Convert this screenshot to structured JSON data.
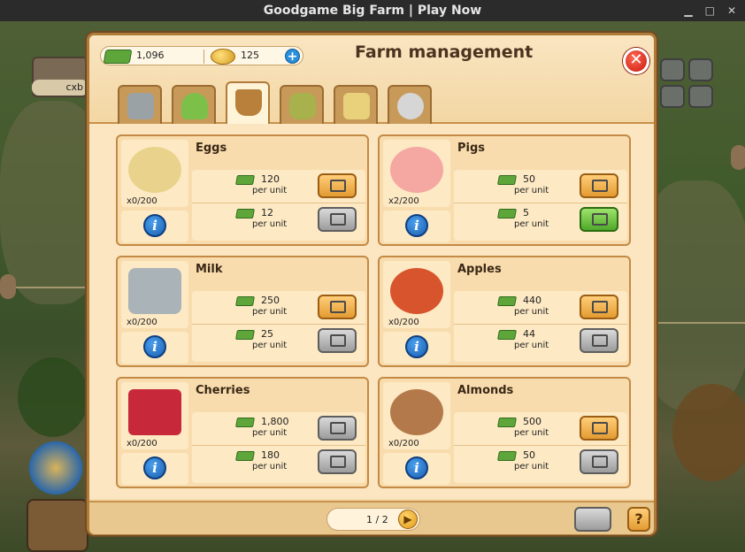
{
  "window": {
    "title": "Goodgame Big Farm | Play Now"
  },
  "hud": {
    "player_label": "cxb"
  },
  "dialog": {
    "title": "Farm management",
    "money": {
      "cash": "1,096",
      "coins": "125"
    },
    "tabs": [
      {
        "icon": "locked-machine-icon",
        "active": false
      },
      {
        "icon": "seedling-icon",
        "active": false
      },
      {
        "icon": "produce-basket-icon",
        "active": true
      },
      {
        "icon": "feed-sack-icon",
        "active": false
      },
      {
        "icon": "seed-packet-icon",
        "active": false
      },
      {
        "icon": "tool-icon",
        "active": false
      }
    ],
    "per_unit_label": "per unit",
    "products": [
      {
        "name": "Eggs",
        "count": "x0/200",
        "buy_price": "120",
        "sell_price": "12",
        "buy_state": "orange",
        "sell_state": "grey",
        "color": "#e9d38c"
      },
      {
        "name": "Pigs",
        "count": "x2/200",
        "buy_price": "50",
        "sell_price": "5",
        "buy_state": "orange",
        "sell_state": "green",
        "color": "#f5a7a2"
      },
      {
        "name": "Milk",
        "count": "x0/200",
        "buy_price": "250",
        "sell_price": "25",
        "buy_state": "orange",
        "sell_state": "grey",
        "color": "#aab3b7"
      },
      {
        "name": "Apples",
        "count": "x0/200",
        "buy_price": "440",
        "sell_price": "44",
        "buy_state": "orange",
        "sell_state": "grey",
        "color": "#d8542c"
      },
      {
        "name": "Cherries",
        "count": "x0/200",
        "buy_price": "1,800",
        "sell_price": "180",
        "buy_state": "grey",
        "sell_state": "grey",
        "color": "#c7283a"
      },
      {
        "name": "Almonds",
        "count": "x0/200",
        "buy_price": "500",
        "sell_price": "50",
        "buy_state": "orange",
        "sell_state": "grey",
        "color": "#b3794a"
      }
    ],
    "pager": {
      "text": "1 / 2"
    },
    "help_label": "?"
  }
}
